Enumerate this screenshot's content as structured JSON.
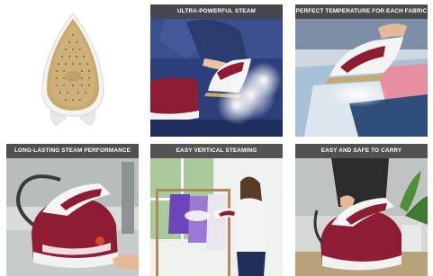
{
  "tiles": [
    {
      "caption": ""
    },
    {
      "caption": "ULTRA-POWERFUL STEAM"
    },
    {
      "caption": "PERFECT TEMPERATURE FOR EACH FABRIC"
    },
    {
      "caption": "LONG-LASTING STEAM PERFORMANCE"
    },
    {
      "caption": "EASY VERTICAL STEAMING"
    },
    {
      "caption": "EASY AND SAFE TO CARRY"
    }
  ],
  "colors": {
    "banner": "#464646",
    "burgundy": "#8e1d33",
    "soleplate_gold": "#c9a96e",
    "white": "#ffffff"
  }
}
